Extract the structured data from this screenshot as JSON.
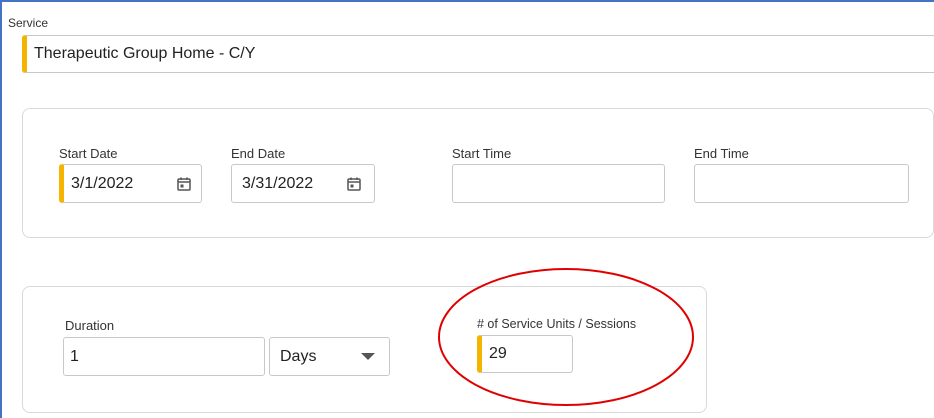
{
  "service": {
    "label": "Service",
    "value": "Therapeutic Group Home - C/Y"
  },
  "dates": {
    "start_date_label": "Start Date",
    "start_date_value": "3/1/2022",
    "end_date_label": "End Date",
    "end_date_value": "3/31/2022",
    "start_time_label": "Start Time",
    "start_time_value": "",
    "end_time_label": "End Time",
    "end_time_value": ""
  },
  "duration": {
    "label": "Duration",
    "value": "1",
    "unit": "Days"
  },
  "units": {
    "label": "# of Service Units / Sessions",
    "value": "29"
  },
  "colors": {
    "required_marker": "#f5b400",
    "highlight_circle": "#e00000",
    "frame": "#4472c4"
  },
  "icons": {
    "date_picker": "calendar-icon",
    "dropdown": "chevron-down-icon"
  }
}
